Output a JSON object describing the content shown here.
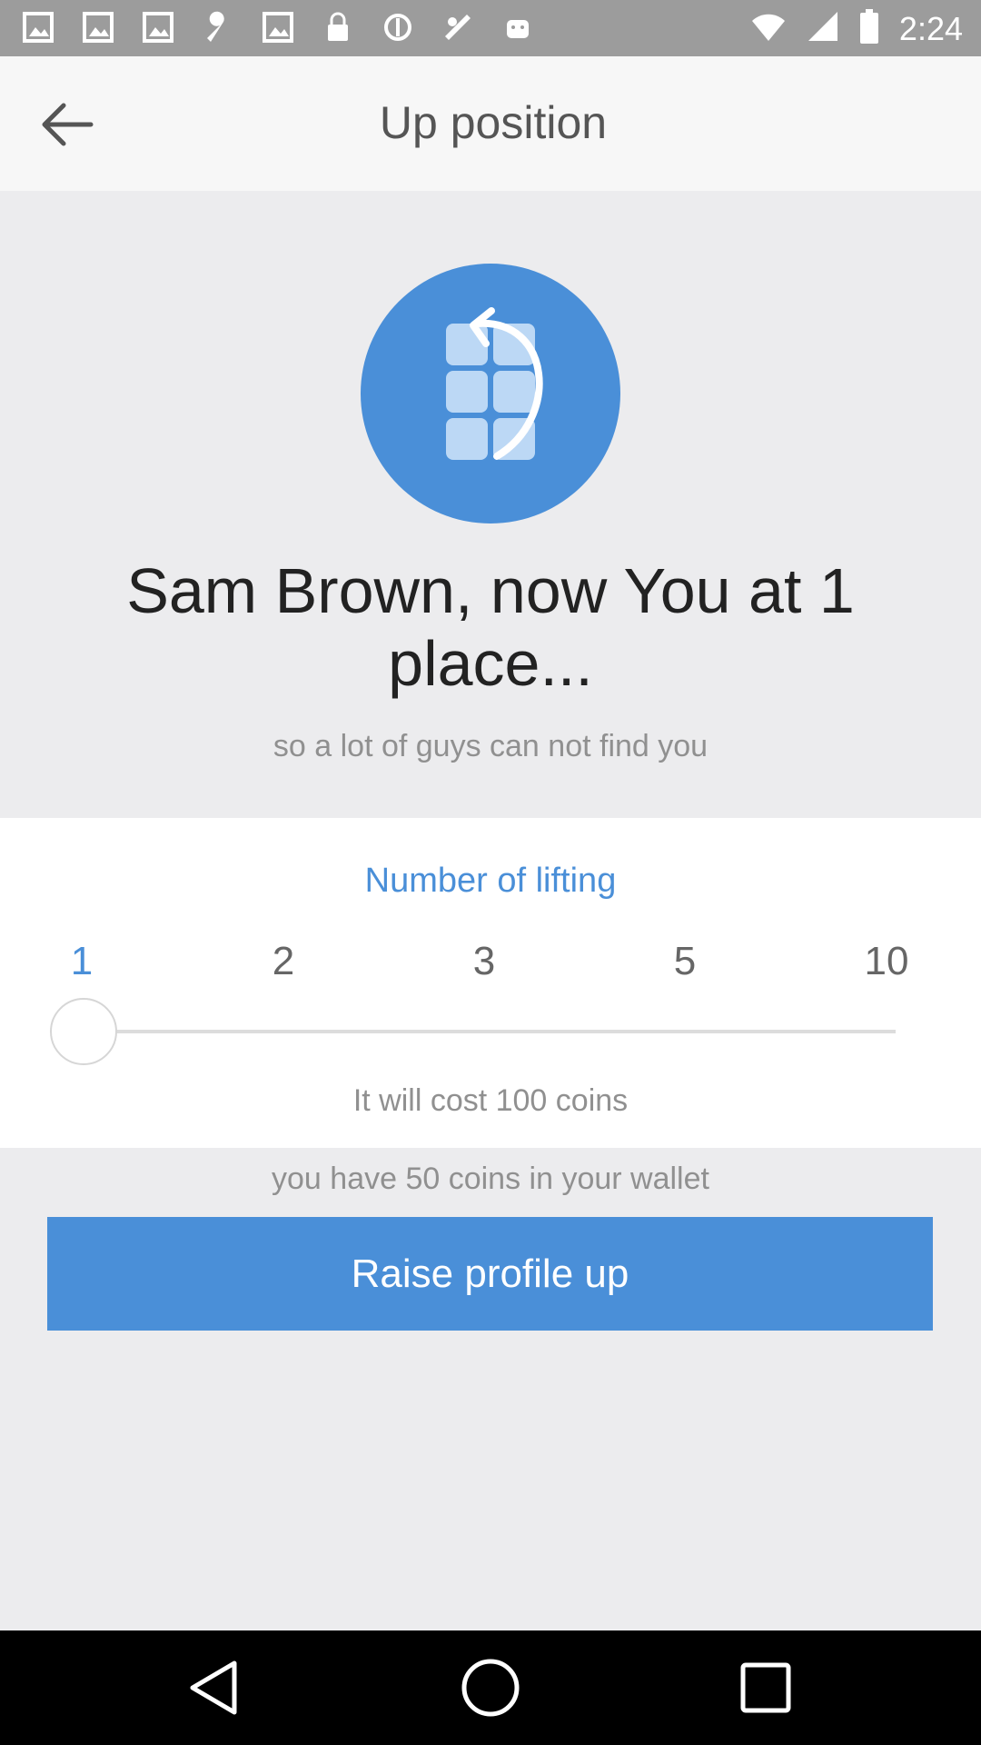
{
  "status_bar": {
    "time": "2:24",
    "icons": [
      "image-icon",
      "image-icon",
      "image-icon",
      "wrench-icon",
      "image-icon",
      "lock-icon",
      "sync-icon",
      "fake-gps-icon",
      "android-icon",
      "wifi-icon",
      "signal-icon",
      "battery-icon"
    ]
  },
  "app_bar": {
    "title": "Up position",
    "back_icon": "arrow-back-icon"
  },
  "hero": {
    "icon": "grid-lift-icon",
    "headline": "Sam Brown, now You at 1 place...",
    "subline": "so a lot of guys can not find you"
  },
  "lifting": {
    "title": "Number of lifting",
    "options": [
      "1",
      "2",
      "3",
      "5",
      "10"
    ],
    "selected": "1",
    "cost_text": "It will cost 100 coins"
  },
  "wallet_text": "you have 50 coins in your wallet",
  "raise_button_label": "Raise profile up",
  "colors": {
    "accent": "#4a8fd8",
    "status_bar": "#9c9c9c",
    "background": "#ececee"
  }
}
